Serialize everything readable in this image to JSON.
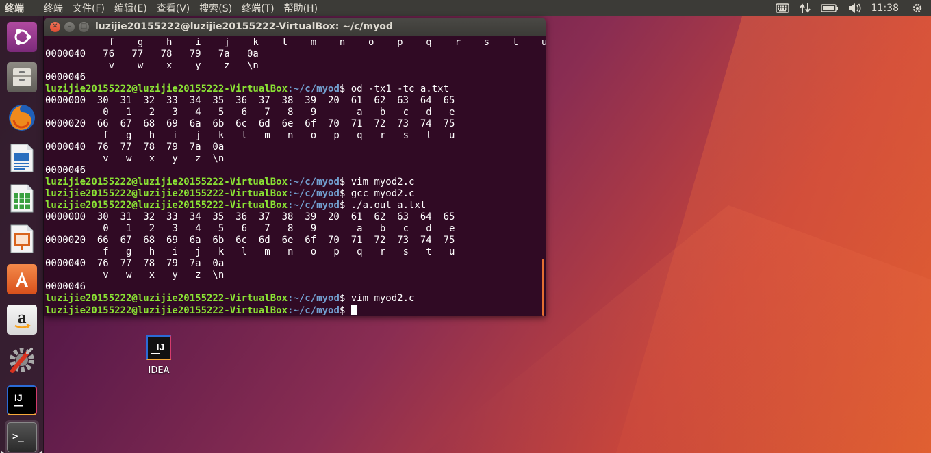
{
  "top_panel": {
    "app_name": "终端",
    "menus": [
      "终端",
      "文件(F)",
      "编辑(E)",
      "查看(V)",
      "搜索(S)",
      "终端(T)",
      "帮助(H)"
    ],
    "clock": "11:38",
    "icons": [
      "keyboard-icon",
      "network-icon",
      "battery-icon",
      "volume-icon",
      "power-gear-icon"
    ]
  },
  "launcher": {
    "items": [
      "ubuntu-dash",
      "files",
      "firefox",
      "libreoffice-writer",
      "libreoffice-calc",
      "libreoffice-impress",
      "ubuntu-software",
      "amazon",
      "system-settings",
      "intellij-idea",
      "terminal"
    ]
  },
  "terminal": {
    "title": "luzijie20155222@luzijie20155222-VirtualBox: ~/c/myod",
    "prompt_user": "luzijie20155222@luzijie20155222-VirtualBox",
    "prompt_path": ":~/c/myod",
    "lines": [
      {
        "type": "out",
        "text": "           f    g    h    i    j    k    l    m    n    o    p    q    r    s    t    u"
      },
      {
        "type": "out",
        "text": "0000040   76   77   78   79   7a   0a"
      },
      {
        "type": "out",
        "text": "           v    w    x    y    z   \\n"
      },
      {
        "type": "out",
        "text": "0000046"
      },
      {
        "type": "cmd",
        "text": "$ od -tx1 -tc a.txt"
      },
      {
        "type": "out",
        "text": "0000000  30  31  32  33  34  35  36  37  38  39  20  61  62  63  64  65"
      },
      {
        "type": "out",
        "text": "          0   1   2   3   4   5   6   7   8   9       a   b   c   d   e"
      },
      {
        "type": "out",
        "text": "0000020  66  67  68  69  6a  6b  6c  6d  6e  6f  70  71  72  73  74  75"
      },
      {
        "type": "out",
        "text": "          f   g   h   i   j   k   l   m   n   o   p   q   r   s   t   u"
      },
      {
        "type": "out",
        "text": "0000040  76  77  78  79  7a  0a"
      },
      {
        "type": "out",
        "text": "          v   w   x   y   z  \\n"
      },
      {
        "type": "out",
        "text": "0000046"
      },
      {
        "type": "cmd",
        "text": "$ vim myod2.c"
      },
      {
        "type": "cmd",
        "text": "$ gcc myod2.c"
      },
      {
        "type": "cmd",
        "text": "$ ./a.out a.txt"
      },
      {
        "type": "out",
        "text": "0000000  30  31  32  33  34  35  36  37  38  39  20  61  62  63  64  65"
      },
      {
        "type": "out",
        "text": "          0   1   2   3   4   5   6   7   8   9       a   b   c   d   e"
      },
      {
        "type": "out",
        "text": "0000020  66  67  68  69  6a  6b  6c  6d  6e  6f  70  71  72  73  74  75"
      },
      {
        "type": "out",
        "text": "          f   g   h   i   j   k   l   m   n   o   p   q   r   s   t   u"
      },
      {
        "type": "out",
        "text": "0000040  76  77  78  79  7a  0a"
      },
      {
        "type": "out",
        "text": "          v   w   x   y   z  \\n"
      },
      {
        "type": "out",
        "text": "0000046"
      },
      {
        "type": "cmd",
        "text": "$ vim myod2.c"
      },
      {
        "type": "cmd",
        "text": "$ "
      }
    ]
  },
  "desktop": {
    "icon_glyph": "IJ",
    "icon_label": "IDEA"
  },
  "colors": {
    "terminal_bg": "#300a24",
    "prompt_user": "#8ae234",
    "prompt_path": "#729fcf",
    "panel_bg": "#3c3b37",
    "close_button": "#e8563b"
  }
}
